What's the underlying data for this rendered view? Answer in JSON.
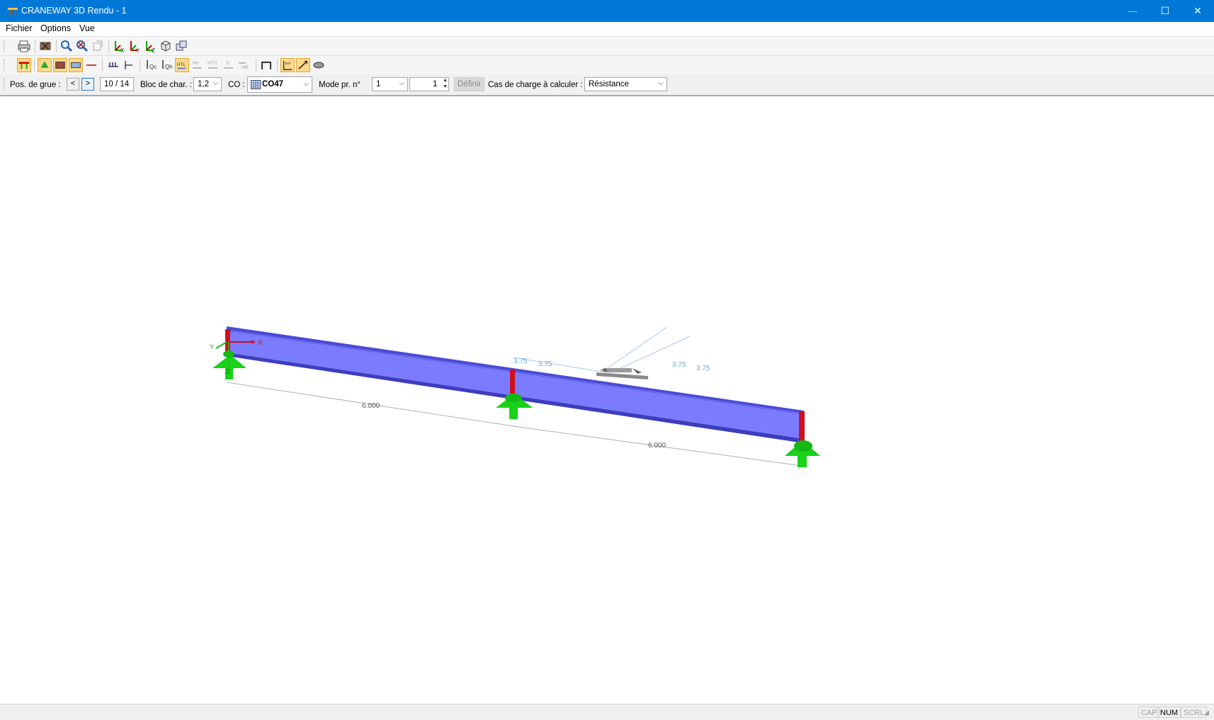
{
  "window": {
    "title": "CRANEWAY 3D Rendu - 1",
    "min_symbol": "—",
    "max_symbol": "☐",
    "close_symbol": "✕"
  },
  "menu": {
    "items": [
      "Fichier",
      "Options",
      "Vue"
    ]
  },
  "toolbar3": {
    "crane_pos_label": "Pos. de grue :",
    "prev_label": "<",
    "next_label": ">",
    "position_value": "10 / 14",
    "load_block_label": "Bloc de char. :",
    "load_block_value": "1,2",
    "co_label": "CO :",
    "co_value": "CO47",
    "mode_label": "Mode pr. n°",
    "mode_value": "1",
    "spin_value": "1",
    "define_label": "Définir",
    "load_case_label": "Cas de charge à calculer :",
    "load_case_value": "Résistance"
  },
  "model": {
    "beam_color": "#7b7bff",
    "support_color": "#19d219",
    "stiffener_color": "#d0101a",
    "span_labels": [
      "6.000",
      "6.000"
    ],
    "load_labels": [
      "3.75",
      "3.75",
      "3.75",
      "3.75"
    ],
    "axis_x": "X",
    "axis_y": "Y",
    "axis_z": "Z"
  },
  "status": {
    "cap": "CAP",
    "num": "NUM",
    "scrl": "SCRL"
  }
}
